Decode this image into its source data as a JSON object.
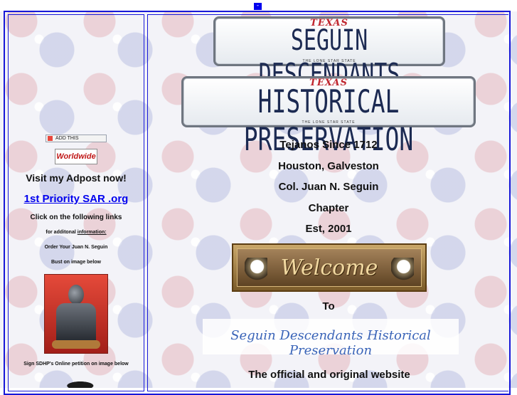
{
  "top": {
    "button_label": "-"
  },
  "plates": {
    "first": {
      "state": "TEXAS",
      "text": "SEGUIN DESCENDANTS",
      "tagline": "THE LONE STAR STATE"
    },
    "second": {
      "state": "TEXAS",
      "text": "HISTORICAL PRESERVATION",
      "tagline": "THE LONE STAR STATE"
    }
  },
  "main": {
    "lines": [
      "Tejanos Since 1712",
      "Houston, Galveston",
      "Col. Juan N. Seguin",
      "Chapter",
      "Est, 2001"
    ],
    "welcome": "Welcome",
    "to": "To",
    "banner": "Seguin Descendants Historical Preservation",
    "official": "The official and original website"
  },
  "sidebar": {
    "addthis_label": "ADD THIS",
    "worldwide_label": "Worldwide",
    "visit": "Visit my Adpost now!",
    "sar_link": "1st Priority SAR .org",
    "click": "Click on the following links",
    "for_additional": "for additonal ",
    "information_link": "information:",
    "order": "Order Your Juan N. Seguin",
    "bust": "Bust on image below",
    "sign": "Sign SDHP's Online petition on image below"
  },
  "colors": {
    "frame": "#1818d8",
    "link": "#0000ee",
    "plate_text": "#1c2a52",
    "plate_state": "#c0262e"
  }
}
